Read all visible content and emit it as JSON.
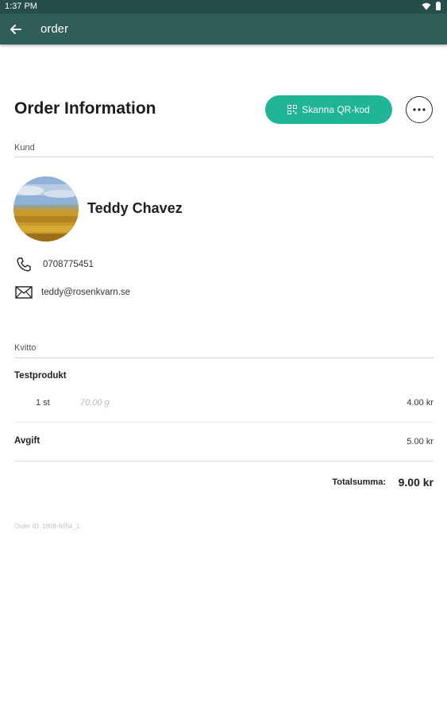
{
  "status_bar": {
    "time": "1:37 PM"
  },
  "app_bar": {
    "title": "order"
  },
  "header": {
    "title": "Order Information",
    "scan_button_label": "Skanna QR-kod",
    "more_icon": "more-horizontal-icon"
  },
  "customer": {
    "section_label": "Kund",
    "name": "Teddy Chavez",
    "phone": "0708775451",
    "email": "teddy@rosenkvarn.se"
  },
  "receipt": {
    "section_label": "Kvitto",
    "product": {
      "name": "Testprodukt",
      "quantity": "1 st",
      "weight": "70.00 g",
      "price": "4.00 kr"
    },
    "fee": {
      "label": "Avgift",
      "amount": "5.00 kr"
    },
    "total": {
      "label": "Totalsumma:",
      "amount": "9.00 kr"
    }
  },
  "order_id": "Order ID: 1808-6654_1",
  "colors": {
    "app_bar": "#2f5e59",
    "status_bar": "#254d49",
    "accent": "#1fb596"
  }
}
